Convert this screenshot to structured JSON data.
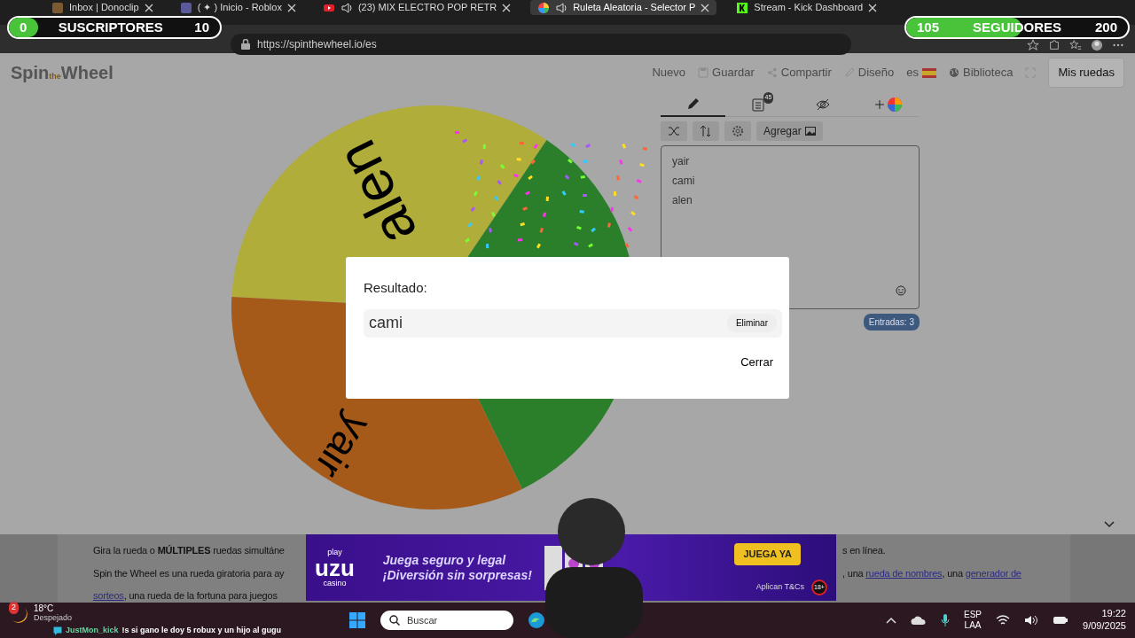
{
  "browser": {
    "tabs": [
      {
        "title": "Inbox | Donoclip",
        "selected": false,
        "audio": false
      },
      {
        "title": "( ✦ ) Inicio - Roblox",
        "selected": false,
        "audio": false
      },
      {
        "title": "(23) MIX ELECTRO POP RETR",
        "selected": false,
        "audio": true
      },
      {
        "title": "Ruleta Aleatoria - Selector P",
        "selected": true,
        "audio": true
      },
      {
        "title": "Stream - Kick Dashboard",
        "selected": false,
        "audio": false
      }
    ],
    "url": "https://spinthewheel.io/es"
  },
  "overlays": {
    "subscribers": {
      "count": "0",
      "label": "SUSCRIPTORES",
      "goal": "10",
      "level": 0
    },
    "followers": {
      "count": "105",
      "label": "SEGUIDORES",
      "goal": "200",
      "level": 0.52
    }
  },
  "site": {
    "logo": "Spin",
    "logo_small": "the",
    "logo_end": "Wheel",
    "nav": [
      {
        "label": "Nuevo"
      },
      {
        "label": "Guardar"
      },
      {
        "label": "Compartir"
      },
      {
        "label": "Diseño"
      },
      {
        "label": "es"
      },
      {
        "label": "Biblioteca"
      }
    ],
    "my_wheels": "Mis ruedas"
  },
  "wheel": {
    "segments": [
      {
        "label": "alen",
        "color": "#b0ad3a"
      },
      {
        "color": "#2b7f2b"
      },
      {
        "label": "yair",
        "color": "#a65a1a"
      }
    ]
  },
  "editor": {
    "tabs": [
      {
        "selected": true
      },
      {
        "selected": false,
        "badge": "45"
      },
      {
        "selected": false
      },
      {
        "selected": false
      }
    ],
    "add_label": "Agregar",
    "entries": [
      "yair",
      "cami",
      "alen"
    ],
    "count": "Entradas: 3"
  },
  "dialog": {
    "title": "Resultado:",
    "result": "cami",
    "remove": "Eliminar",
    "close": "Cerrar"
  },
  "article": {
    "p1_left": "Gira la rueda o **MÚLTIPLES** ruedas simultáne",
    "p1_right": "s en línea.",
    "p2_left": "Spin the Wheel es una rueda giratoria para ay",
    "p2_right": [
      {
        "text": ", una ",
        "link": false
      },
      {
        "text": "rueda de nombres",
        "link": true
      },
      {
        "text": ", una ",
        "link": false
      },
      {
        "text": "generador de",
        "link": true
      }
    ],
    "p3": [
      {
        "text": "sorteos",
        "link": true
      },
      {
        "text": ", una rueda de la fortuna para juegos",
        "link": false
      }
    ]
  },
  "ad": {
    "brand_top": "play",
    "brand": "uzu",
    "brand_bottom": "casino",
    "line1": "Juega seguro y legal",
    "line2": "¡Diversión sin sorpresas!",
    "cta": "JUEGA YA",
    "terms": "Aplican T&Cs",
    "age": "18+"
  },
  "taskbar": {
    "weather_badge": "2",
    "temperature": "18°C",
    "condition": "Despejado",
    "search": "Buscar",
    "lang1": "ESP",
    "lang2": "LAA",
    "time": "19:22",
    "date": "9/09/2025"
  },
  "chat": {
    "user": "JustMon_kick",
    "message": "!s si gano le doy 5 robux y un hijo al gugu"
  }
}
